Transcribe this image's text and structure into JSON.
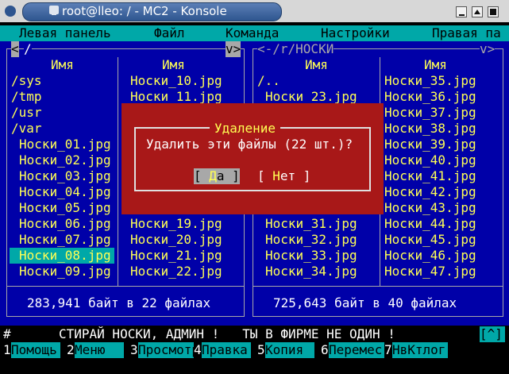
{
  "window": {
    "title": "root@lleo: / - MC2 - Konsole"
  },
  "menubar": {
    "items": [
      "Левая панель",
      "Файл",
      "Команда",
      "Настройки",
      "Правая па"
    ]
  },
  "left_panel": {
    "path": "/",
    "sort_indicator": "v>",
    "nav": "<",
    "column_header": "Имя",
    "col1": [
      "/sys",
      "/tmp",
      "/usr",
      "/var",
      "Носки_01.jpg",
      "Носки_02.jpg",
      "Носки_03.jpg",
      "Носки_04.jpg",
      "Носки_05.jpg",
      "Носки_06.jpg",
      "Носки_07.jpg",
      "Носки_08.jpg",
      "Носки_09.jpg"
    ],
    "col2": [
      "Носки_10.jpg",
      "Носки_11.jpg",
      "",
      "",
      "",
      "",
      "",
      "",
      "",
      "Носки_19.jpg",
      "Носки_20.jpg",
      "Носки_21.jpg",
      "Носки_22.jpg"
    ],
    "selected_index": 11,
    "status": "283,941 байт в 22 файлах"
  },
  "right_panel": {
    "path": "<-/r/НОСКИ",
    "sort_indicator": "v>",
    "column_header": "Имя",
    "col1": [
      "/..",
      "Носки_23.jpg",
      "",
      "",
      "",
      "",
      "",
      "",
      "",
      "Носки_31.jpg",
      "Носки_32.jpg",
      "Носки_33.jpg",
      "Носки_34.jpg"
    ],
    "col2": [
      "Носки_35.jpg",
      "Носки_36.jpg",
      "Носки_37.jpg",
      "Носки_38.jpg",
      "Носки_39.jpg",
      "Носки_40.jpg",
      "Носки_41.jpg",
      "Носки_42.jpg",
      "Носки_43.jpg",
      "Носки_44.jpg",
      "Носки_45.jpg",
      "Носки_46.jpg",
      "Носки_47.jpg"
    ],
    "status": "725,643 байт в 40 файлах"
  },
  "dialog": {
    "title": "Удаление",
    "message": "Удалить эти файлы (22 шт.)?",
    "yes_label": "[ Да ]",
    "no_label": "[ Нет ]"
  },
  "command_line": {
    "prompt": "#",
    "text": "СТИРАЙ НОСКИ, АДМИН !   ТЫ В ФИРМЕ НЕ ОДИН !",
    "history": "[^]"
  },
  "fkeys": [
    {
      "num": "1",
      "label": "Помощь"
    },
    {
      "num": "2",
      "label": "Меню"
    },
    {
      "num": "3",
      "label": "Просмотр"
    },
    {
      "num": "4",
      "label": "Правка"
    },
    {
      "num": "5",
      "label": "Копия"
    },
    {
      "num": "6",
      "label": "Перемес"
    },
    {
      "num": "7",
      "label": "НвКтлог"
    }
  ]
}
